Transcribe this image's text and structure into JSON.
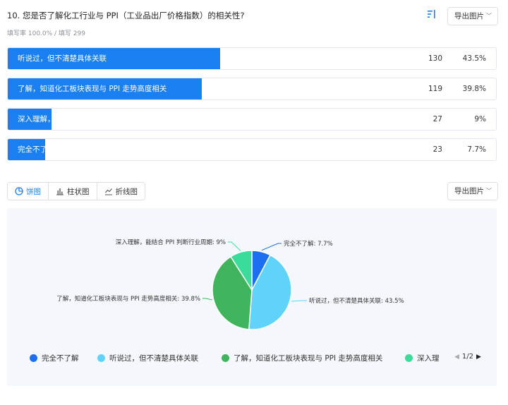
{
  "question": {
    "title": "10. 您是否了解化工行业与 PPI（工业品出厂价格指数）的相关性?",
    "meta": "填写率 100.0% / 填写 299"
  },
  "toolbar": {
    "sort_icon": "sort-icon",
    "export_label": "导出图片"
  },
  "options": [
    {
      "label": "听说过，但不清楚具体关联",
      "count": "130",
      "percent": "43.5%",
      "fraction": 0.435,
      "color": "#5fd3fa"
    },
    {
      "label": "了解，知道化工板块表现与 PPI 走势高度相关",
      "count": "119",
      "percent": "39.8%",
      "fraction": 0.398,
      "color": "#3fb45d"
    },
    {
      "label": "深入理解，能结合 PPI 判断行业周期",
      "count": "27",
      "percent": "9%",
      "fraction": 0.09,
      "color": "#3bdc9a"
    },
    {
      "label": "完全不了解",
      "count": "23",
      "percent": "7.7%",
      "fraction": 0.077,
      "color": "#1e6ff0"
    }
  ],
  "tabs": [
    {
      "label": "饼图",
      "icon": "pie-icon",
      "active": true
    },
    {
      "label": "柱状图",
      "icon": "bar-chart-icon",
      "active": false
    },
    {
      "label": "折线图",
      "icon": "line-chart-icon",
      "active": false
    }
  ],
  "chart_export_label": "导出图片",
  "chart_data": {
    "type": "pie",
    "title": "",
    "slices": [
      {
        "name": "完全不了解",
        "value": 7.7,
        "color": "#1e6ff0",
        "label": "完全不了解: 7.7%"
      },
      {
        "name": "听说过，但不清楚具体关联",
        "value": 43.5,
        "color": "#5fd3fa",
        "label": "听说过，但不清楚具体关联: 43.5%"
      },
      {
        "name": "了解，知道化工板块表现与 PPI 走势高度相关",
        "value": 39.8,
        "color": "#3fb45d",
        "label": "了解，知道化工板块表现与 PPI 走势高度相关: 39.8%"
      },
      {
        "name": "深入理解，能结合 PPI 判断行业周期",
        "value": 9,
        "color": "#3bdc9a",
        "label": "深入理解，能结合 PPI 判断行业周期: 9%"
      }
    ],
    "legend": {
      "placement": "bottom",
      "items": [
        {
          "name": "完全不了解",
          "color": "#1e6ff0"
        },
        {
          "name": "听说过，但不清楚具体关联",
          "color": "#5fd3fa"
        },
        {
          "name": "了解，知道化工板块表现与 PPI 走势高度相关",
          "color": "#3fb45d"
        },
        {
          "name": "深入理",
          "color": "#3bdc9a"
        }
      ],
      "page": "1/2"
    }
  }
}
